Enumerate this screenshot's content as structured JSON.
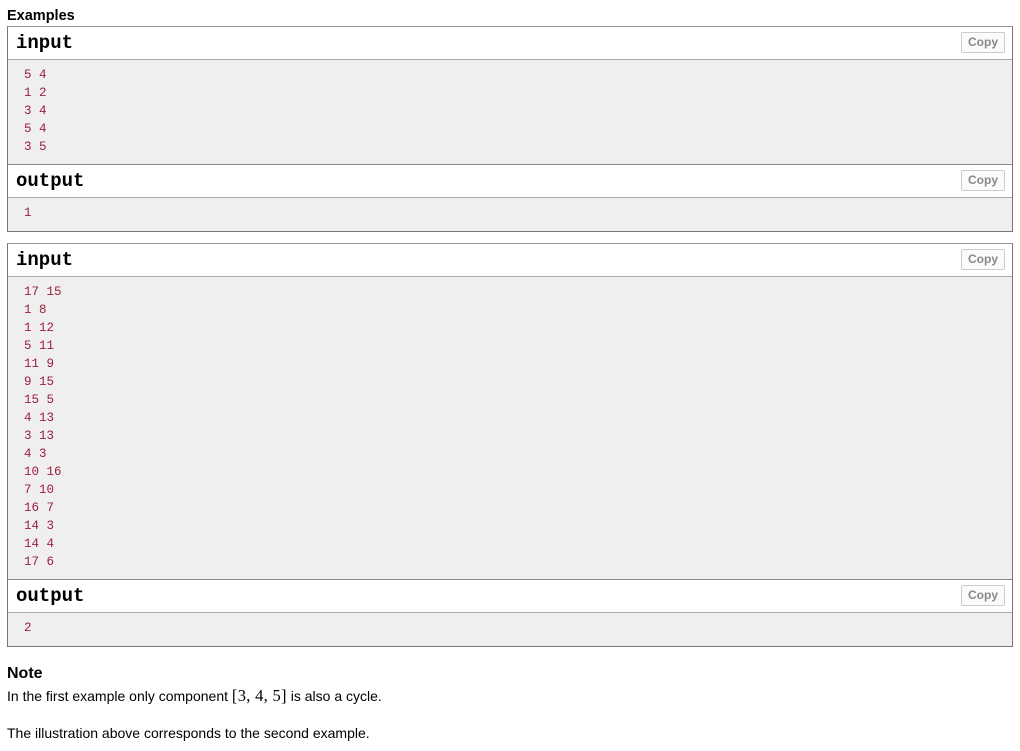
{
  "examples": {
    "heading": "Examples",
    "copy_label": "Copy",
    "tests": [
      {
        "input_label": "input",
        "input_text": "5 4\n1 2\n3 4\n5 4\n3 5",
        "output_label": "output",
        "output_text": "1"
      },
      {
        "input_label": "input",
        "input_text": "17 15\n1 8\n1 12\n5 11\n11 9\n9 15\n15 5\n4 13\n3 13\n4 3\n10 16\n7 10\n16 7\n14 3\n14 4\n17 6",
        "output_label": "output",
        "output_text": "2"
      }
    ]
  },
  "note": {
    "heading": "Note",
    "paragraph_1_before": "In the first example only component ",
    "paragraph_1_math": "[3, 4, 5]",
    "paragraph_1_after": " is also a cycle.",
    "paragraph_2": "The illustration above corresponds to the second example."
  },
  "colors": {
    "code_text": "#9c1f3c",
    "code_background": "#efefef",
    "container_border": "#777777",
    "copy_button_text": "#888888"
  }
}
